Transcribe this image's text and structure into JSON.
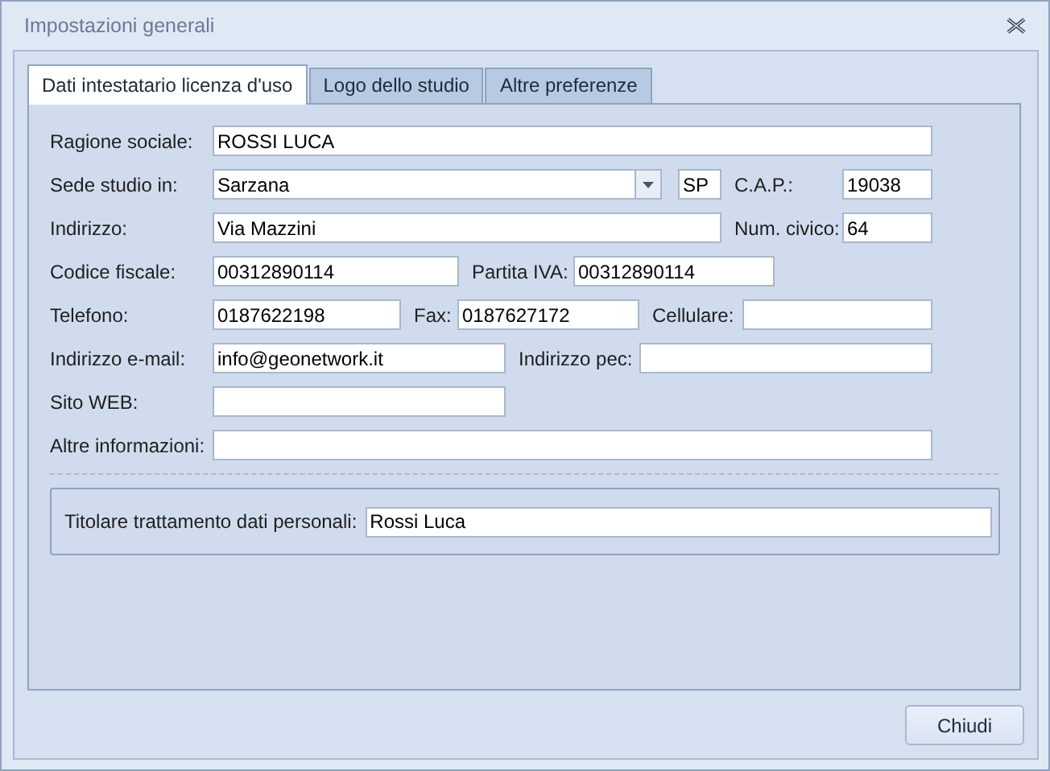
{
  "window": {
    "title": "Impostazioni generali"
  },
  "tabs": [
    {
      "label": "Dati intestatario licenza d'uso",
      "selected": true
    },
    {
      "label": "Logo dello studio",
      "selected": false
    },
    {
      "label": "Altre preferenze",
      "selected": false
    }
  ],
  "form_rows": [
    [
      {
        "label": "Ragione sociale:",
        "value": "ROSSI LUCA",
        "kind": "text"
      }
    ],
    [
      {
        "label": "Sede studio in:",
        "value": "Sarzana",
        "kind": "combo"
      },
      {
        "value": "SP",
        "kind": "text"
      },
      {
        "label": "C.A.P.:",
        "value": "19038",
        "kind": "text"
      }
    ],
    [
      {
        "label": "Indirizzo:",
        "value": "Via Mazzini",
        "kind": "text"
      },
      {
        "label": "Num. civico:",
        "value": "64",
        "kind": "text"
      }
    ],
    [
      {
        "label": "Codice fiscale:",
        "value": "00312890114",
        "kind": "text"
      },
      {
        "label": "Partita IVA:",
        "value": "00312890114",
        "kind": "text"
      }
    ],
    [
      {
        "label": "Telefono:",
        "value": "0187622198",
        "kind": "text"
      },
      {
        "label": "Fax:",
        "value": "0187627172",
        "kind": "text"
      },
      {
        "label": "Cellulare:",
        "kind": "text"
      }
    ],
    [
      {
        "label": "Indirizzo e-mail:",
        "value": "info@geonetwork.it",
        "kind": "text"
      },
      {
        "label": "Indirizzo pec:",
        "kind": "text"
      }
    ],
    [
      {
        "label": "Sito WEB:",
        "kind": "text"
      }
    ],
    [
      {
        "label": "Altre informazioni:",
        "kind": "text"
      }
    ]
  ],
  "privacy_group": {
    "label": "Titolare trattamento dati personali:",
    "value": "Rossi Luca"
  },
  "buttons": [
    "Chiudi"
  ]
}
